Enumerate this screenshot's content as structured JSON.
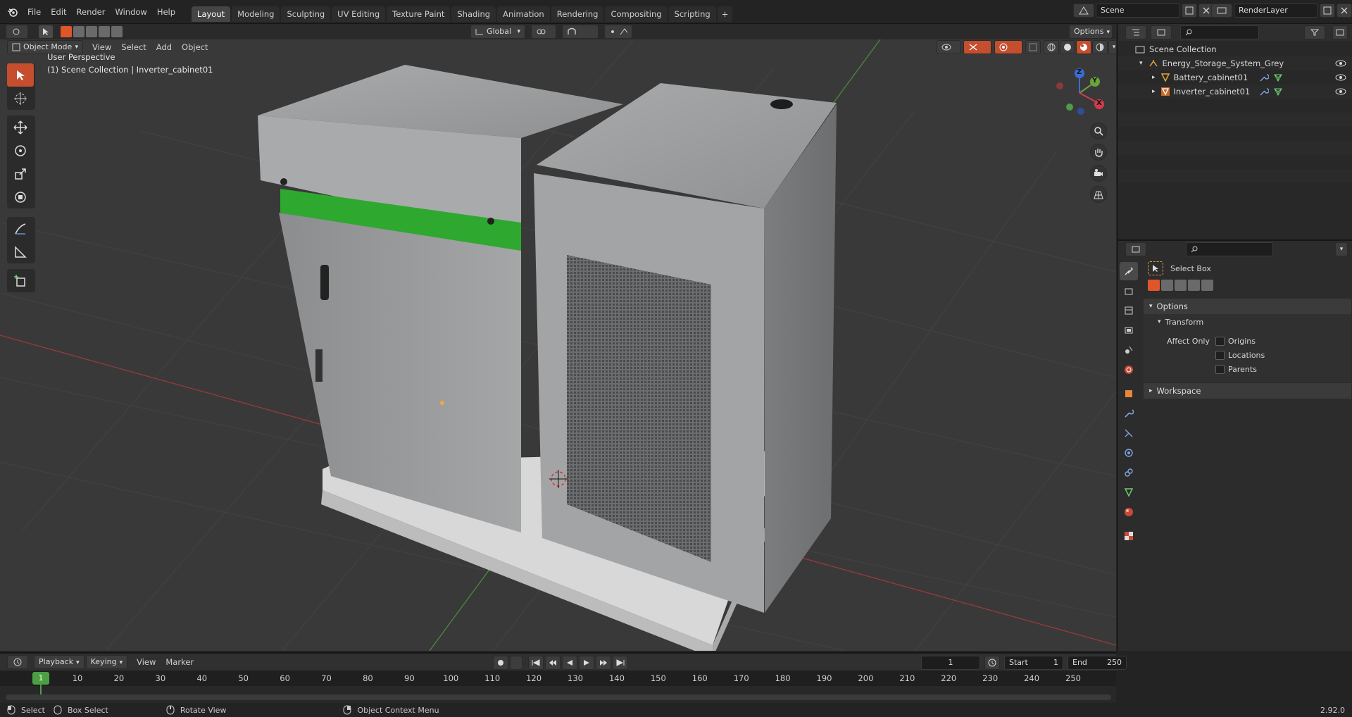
{
  "menus": [
    "File",
    "Edit",
    "Render",
    "Window",
    "Help"
  ],
  "workspace_tabs": [
    {
      "label": "Layout",
      "active": true
    },
    {
      "label": "Modeling"
    },
    {
      "label": "Sculpting"
    },
    {
      "label": "UV Editing"
    },
    {
      "label": "Texture Paint"
    },
    {
      "label": "Shading"
    },
    {
      "label": "Animation"
    },
    {
      "label": "Rendering"
    },
    {
      "label": "Compositing"
    },
    {
      "label": "Scripting"
    }
  ],
  "add_tab": "+",
  "scene": {
    "label": "Scene"
  },
  "render_layer": {
    "label": "RenderLayer"
  },
  "viewport": {
    "mode": "Object Mode",
    "menus": [
      "View",
      "Select",
      "Add",
      "Object"
    ],
    "transform_orientation": "Global",
    "options_label": "Options",
    "overlay_line1": "User Perspective",
    "overlay_line2": "(1) Scene Collection | Inverter_cabinet01"
  },
  "gizmo": {
    "z": "Z",
    "y": "Y",
    "x": "X"
  },
  "outliner": {
    "root": "Scene Collection",
    "items": [
      {
        "label": "Energy_Storage_System_Grey"
      },
      {
        "label": "Battery_cabinet01"
      },
      {
        "label": "Inverter_cabinet01"
      }
    ]
  },
  "properties": {
    "tool_name": "Select Box",
    "options_panel": "Options",
    "transform_panel": "Transform",
    "affect_only": "Affect Only",
    "checkboxes": [
      "Origins",
      "Locations",
      "Parents"
    ],
    "workspace_panel": "Workspace"
  },
  "timeline": {
    "menus": [
      "Playback",
      "Keying",
      "View",
      "Marker"
    ],
    "current_frame": "1",
    "start_label": "Start",
    "start": "1",
    "end_label": "End",
    "end": "250",
    "marker_frame": "1",
    "ticks": [
      "10",
      "20",
      "30",
      "40",
      "50",
      "60",
      "70",
      "80",
      "90",
      "100",
      "110",
      "120",
      "130",
      "140",
      "150",
      "160",
      "170",
      "180",
      "190",
      "200",
      "210",
      "220",
      "230",
      "240",
      "250"
    ]
  },
  "status": {
    "select": "Select",
    "box_select": "Box Select",
    "rotate_view": "Rotate View",
    "context_menu": "Object Context Menu",
    "version": "2.92.0"
  }
}
